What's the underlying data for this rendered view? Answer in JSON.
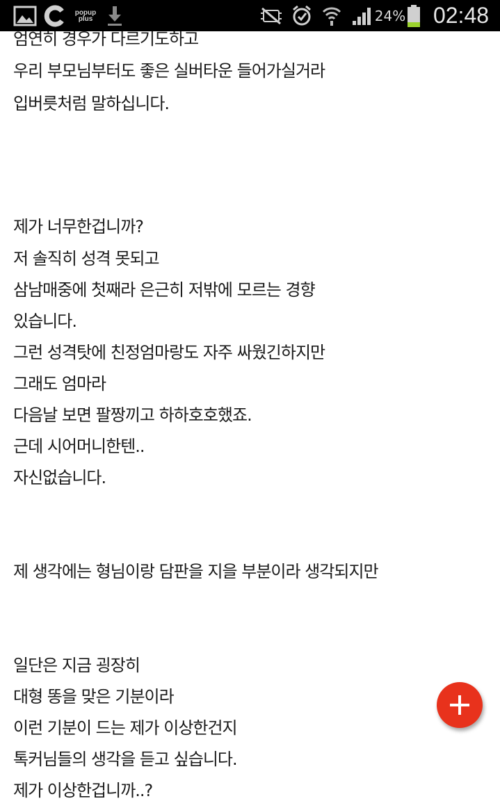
{
  "status_bar": {
    "icons": [
      "gallery-icon",
      "c-app-icon",
      "popup-plus-icon",
      "download-icon",
      "mute-icon",
      "alarm-icon",
      "wifi-icon",
      "signal-icon",
      "battery-icon"
    ],
    "popup_line1": "popup",
    "popup_line2": "plus",
    "battery_percent": "24%",
    "battery_level": 0.24,
    "time": "02:48"
  },
  "post": {
    "lines": [
      "엄연히 경우가 다르기도하고",
      "우리 부모님부터도 좋은 실버타운 들어가실거라",
      "입버릇처럼 말하십니다.",
      "제가 너무한겁니까?",
      "저 솔직히 성격 못되고",
      "삼남매중에 첫째라 은근히 저밖에 모르는 경향",
      "있습니다.",
      "그런 성격탓에 친정엄마랑도 자주 싸웠긴하지만",
      "그래도 엄마라",
      "다음날 보면 팔짱끼고 하하호호했죠.",
      "근데 시어머니한텐..",
      "자신없습니다.",
      "제 생각에는 형님이랑 담판을 지을 부분이라 생각되지만",
      "일단은 지금 굉장히",
      "대형 똥을 맞은 기분이라",
      "이런 기분이 드는 제가 이상한건지",
      "톡커님들의 생각을 듣고 싶습니다.",
      "제가 이상한겁니까..?"
    ]
  },
  "fab": {
    "icon": "plus-icon",
    "color": "#e8321c"
  }
}
